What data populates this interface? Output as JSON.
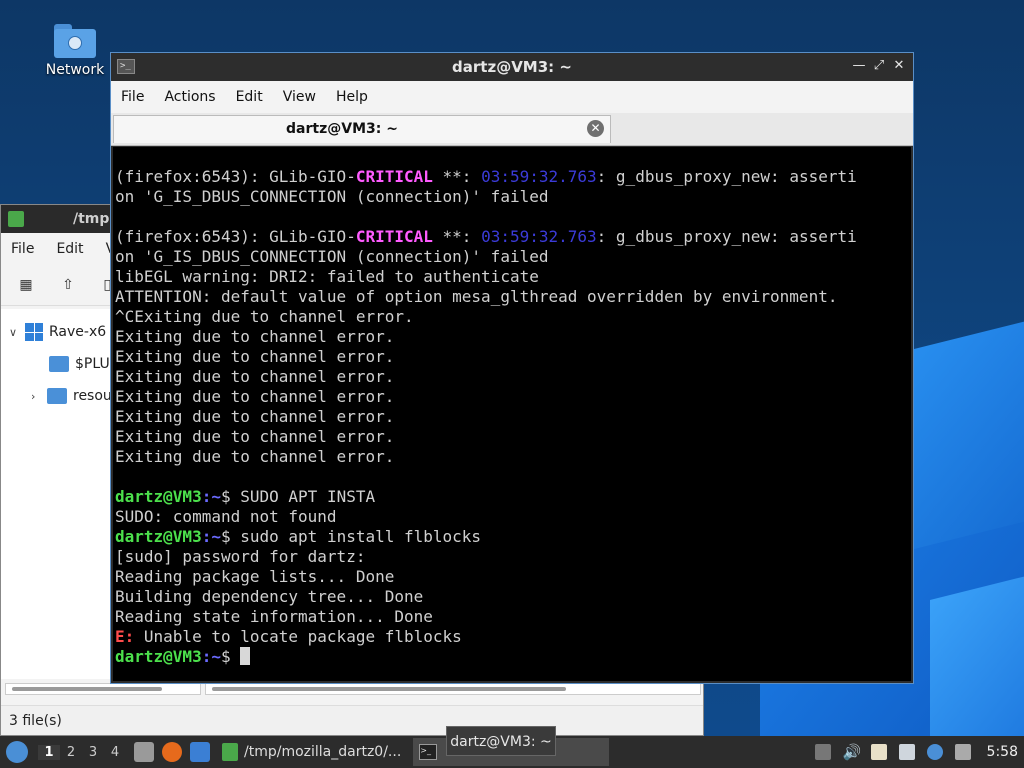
{
  "desktop": {
    "icon_label": "Network"
  },
  "file_manager": {
    "title": "/tmp",
    "menu": [
      "File",
      "Edit",
      "V"
    ],
    "tree": {
      "root_label": "Rave-x6",
      "child1_label": "$PLU",
      "child2_label": "resou"
    },
    "status": "3 file(s)"
  },
  "terminal": {
    "title": "dartz@VM3: ~",
    "menu": {
      "file": "File",
      "actions": "Actions",
      "edit": "Edit",
      "view": "View",
      "help": "Help"
    },
    "tab_label": "dartz@VM3: ~",
    "prompt_user": "dartz@VM3",
    "prompt_path": ":~",
    "dollar": "$",
    "lines": {
      "l1_pre": "(firefox:6543): GLib-GIO-",
      "critical": "CRITICAL",
      "stars": " **: ",
      "ts1": "03:59:32.763",
      "l1_post": ": g_dbus_proxy_new: asserti",
      "l2": "on 'G_IS_DBUS_CONNECTION (connection)' failed",
      "ts2": "03:59:32.763",
      "egl": "libEGL warning: DRI2: failed to authenticate",
      "attention": "ATTENTION: default value of option mesa_glthread overridden by environment.",
      "ctrlc": "^CExiting due to channel error.",
      "exiting": "Exiting due to channel error.",
      "cmd1": " SUDO APT INSTA",
      "sudo_nf": "SUDO: command not found",
      "cmd2": " sudo apt install flblocks",
      "pw": "[sudo] password for dartz:",
      "reading": "Reading package lists... Done",
      "building": "Building dependency tree... Done",
      "state": "Reading state information... Done",
      "e": "E:",
      "unable": " Unable to locate package flblocks"
    }
  },
  "taskbar": {
    "workspaces": [
      "1",
      "2",
      "3",
      "4"
    ],
    "task_fm": "/tmp/mozilla_dartz0/...",
    "clock": "5:58"
  },
  "tooltip": "dartz@VM3: ~"
}
